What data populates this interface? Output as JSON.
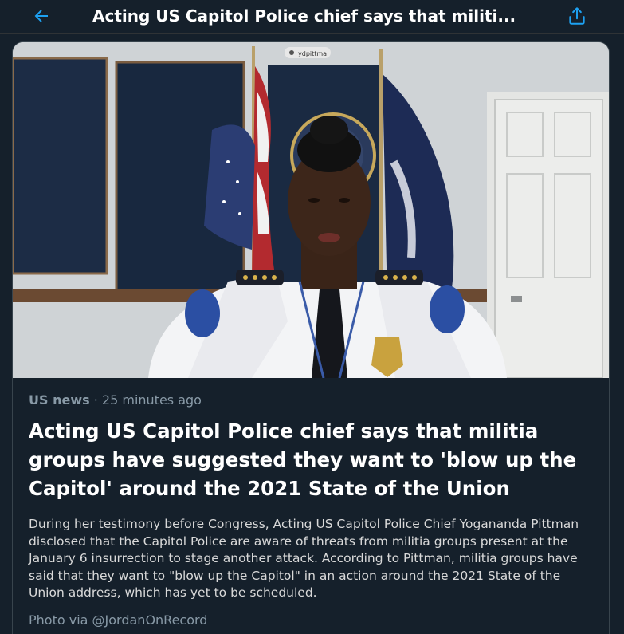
{
  "header": {
    "title": "Acting US Capitol Police chief says that militi..."
  },
  "icons": {
    "back": "arrow-left-icon",
    "share": "share-upload-icon"
  },
  "colors": {
    "accent": "#1da1f2",
    "background": "#15202b",
    "muted": "#8899a6"
  },
  "media": {
    "video_label": "ydpittma"
  },
  "story": {
    "category": "US news",
    "separator": " · ",
    "time": "25 minutes ago",
    "headline": "Acting US Capitol Police chief says that militia groups have suggested they want to 'blow up the Capitol' around the 2021 State of the Union",
    "body": "During her testimony before Congress, Acting US Capitol Police Chief Yogananda Pittman disclosed that the Capitol Police are aware of threats from militia groups present at the January 6 insurrection to stage another attack. According to Pittman, militia groups have said that they want to \"blow up the Capitol\" in an action around the 2021 State of the Union address, which has yet to be scheduled.",
    "photo_credit": "Photo via @JordanOnRecord"
  }
}
